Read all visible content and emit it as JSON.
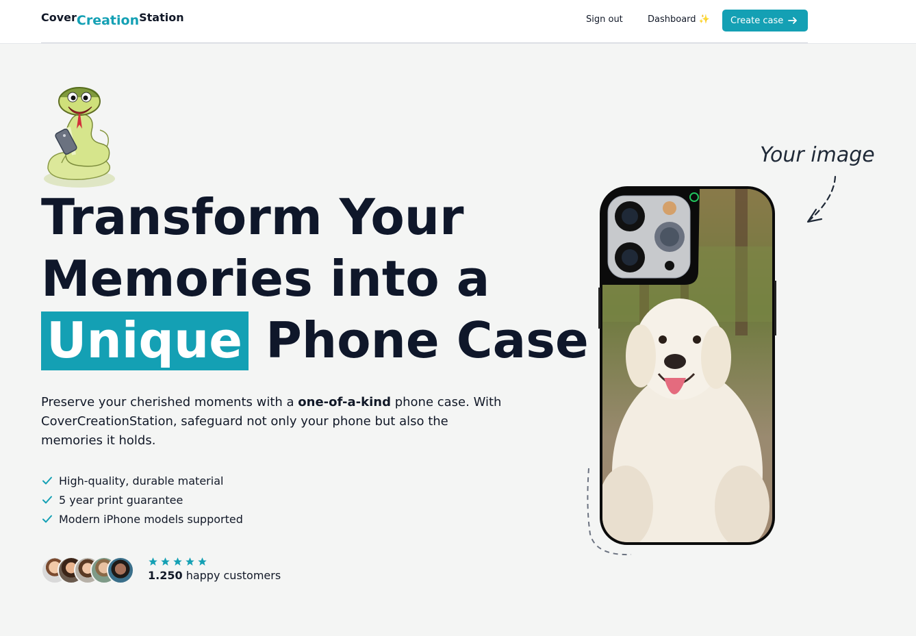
{
  "nav": {
    "logo": {
      "part1": "Cover",
      "part2": "Creation",
      "part3": "Station"
    },
    "sign_out": "Sign out",
    "dashboard": "Dashboard ✨",
    "create_case": "Create case"
  },
  "hero": {
    "headline": {
      "line1": "Transform Your",
      "line2": "Memories into a",
      "highlight": "Unique",
      "line3_rest": "Phone Case"
    },
    "description": {
      "before": "Preserve your cherished moments with a ",
      "bold": "one-of-a-kind",
      "after": " phone case. With CoverCreationStation, safeguard not only your phone but also the memories it holds."
    },
    "features": [
      "High-quality, durable material",
      "5 year print guarantee",
      "Modern iPhone models supported"
    ],
    "rating": {
      "stars": 5,
      "count": "1.250",
      "label": " happy customers"
    },
    "annotation": "Your image"
  },
  "colors": {
    "accent": "#14a0b4",
    "text": "#0f172a",
    "background": "#f4f5f4"
  },
  "icons": [
    "arrow-right-icon",
    "check-icon",
    "star-icon",
    "snake-mascot",
    "curved-arrow-icon"
  ]
}
